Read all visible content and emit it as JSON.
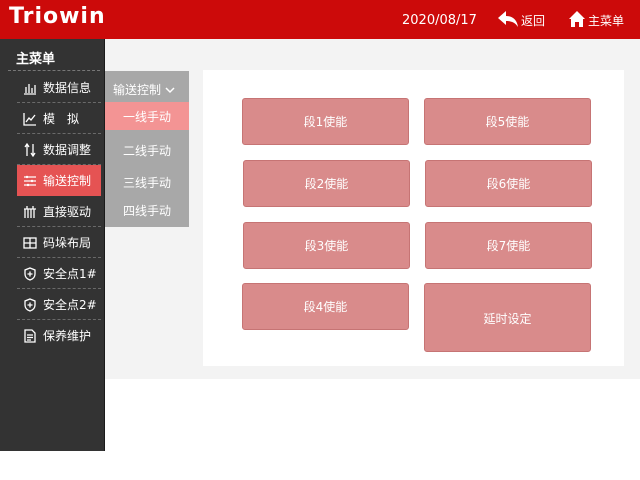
{
  "header": {
    "logo": "Triowin",
    "date": "2020/08/17",
    "back_label": "返回",
    "home_label": "主菜单"
  },
  "sidebar": {
    "title": "主菜单",
    "items": [
      {
        "label": "数据信息",
        "icon": "bar-chart-icon"
      },
      {
        "label": "模　拟",
        "icon": "line-chart-icon"
      },
      {
        "label": "数据调整",
        "icon": "sort-arrows-icon"
      },
      {
        "label": "输送控制",
        "icon": "list-icon",
        "active": true
      },
      {
        "label": "直接驱动",
        "icon": "comb-icon"
      },
      {
        "label": "码垛布局",
        "icon": "grid-icon"
      },
      {
        "label": "安全点1#",
        "icon": "shield-plus-icon"
      },
      {
        "label": "安全点2#",
        "icon": "shield-plus-icon"
      },
      {
        "label": "保养维护",
        "icon": "document-icon"
      }
    ]
  },
  "submenu": {
    "title": "输送控制",
    "items": [
      {
        "label": "一线手动",
        "active": true
      },
      {
        "label": "二线手动"
      },
      {
        "label": "三线手动"
      },
      {
        "label": "四线手动"
      }
    ]
  },
  "segments": {
    "s1": "段1使能",
    "s2": "段2使能",
    "s3": "段3使能",
    "s4": "段4使能",
    "s5": "段5使能",
    "s6": "段6使能",
    "s7": "段7使能",
    "delay": "延时设定"
  },
  "colors": {
    "header": "#cc0a0a",
    "sidebar": "#333333",
    "active_item": "#e55353",
    "submenu": "#a8a8a8",
    "submenu_active": "#f39494",
    "button": "#d98b8b"
  }
}
